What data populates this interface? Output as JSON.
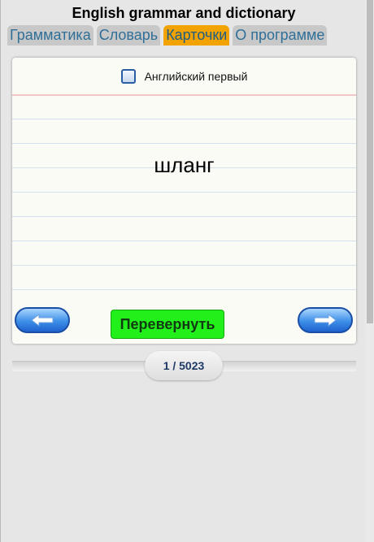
{
  "app": {
    "title": "English grammar and dictionary"
  },
  "tabs": [
    {
      "label": "Грамматика",
      "active": false
    },
    {
      "label": "Словарь",
      "active": false
    },
    {
      "label": "Карточки",
      "active": true
    },
    {
      "label": "О программе",
      "active": false
    }
  ],
  "card": {
    "checkbox_label": "Английский первый",
    "checkbox_checked": false,
    "word": "шланг",
    "flip_label": "Перевернуть"
  },
  "pager": {
    "text": "1 / 5023"
  },
  "colors": {
    "active_tab": "#f2a300",
    "flip_button": "#22f01a",
    "nav_button": "#3d8fe8"
  },
  "icons": {
    "prev": "arrow-left-icon",
    "next": "arrow-right-icon"
  }
}
